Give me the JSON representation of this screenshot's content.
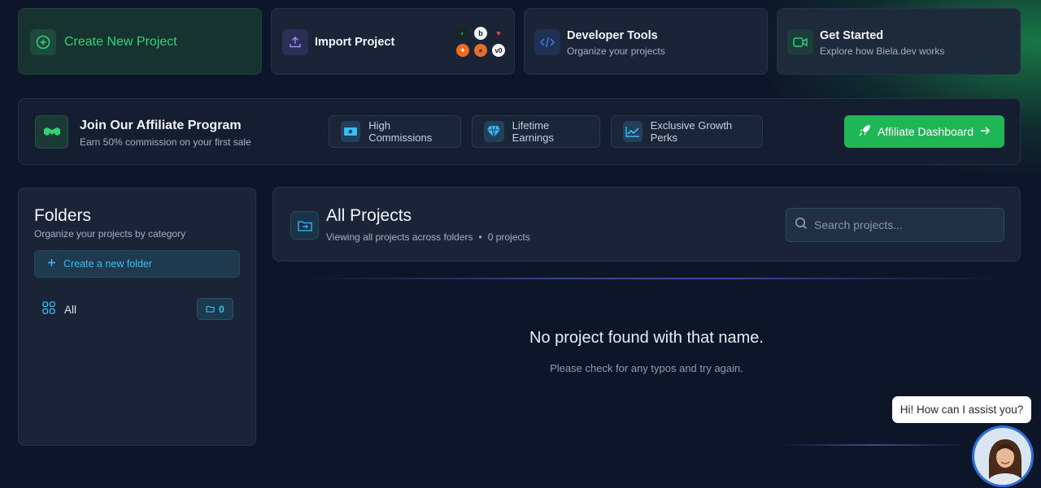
{
  "top_cards": {
    "create": {
      "title": "Create New Project"
    },
    "import": {
      "title": "Import Project",
      "logos": [
        "github-logo",
        "bolt-logo",
        "lovable-logo",
        "replit-logo",
        "basketball-logo",
        "v0-logo"
      ]
    },
    "devtools": {
      "title": "Developer Tools",
      "subtitle": "Organize your projects"
    },
    "started": {
      "title": "Get Started",
      "subtitle": "Explore how Biela.dev works"
    }
  },
  "affiliate": {
    "title": "Join Our Affiliate Program",
    "subtitle": "Earn 50% commission on your first sale",
    "perks": [
      "High Commissions",
      "Lifetime Earnings",
      "Exclusive Growth Perks"
    ],
    "button_label": "Affiliate Dashboard"
  },
  "folders": {
    "title": "Folders",
    "subtitle": "Organize your projects by category",
    "new_folder_label": "Create a new folder",
    "items": [
      {
        "label": "All",
        "count": "0"
      }
    ]
  },
  "projects": {
    "title": "All Projects",
    "subtitle": "Viewing all projects across folders",
    "count_text": "0 projects",
    "search_placeholder": "Search projects...",
    "empty_title": "No project found with that name.",
    "empty_subtitle": "Please check for any typos and try again."
  },
  "chat": {
    "bubble": "Hi! How can I assist you?"
  },
  "colors": {
    "accent_green": "#1fb755",
    "accent_cyan": "#38bdf8",
    "background": "#0d1628"
  }
}
